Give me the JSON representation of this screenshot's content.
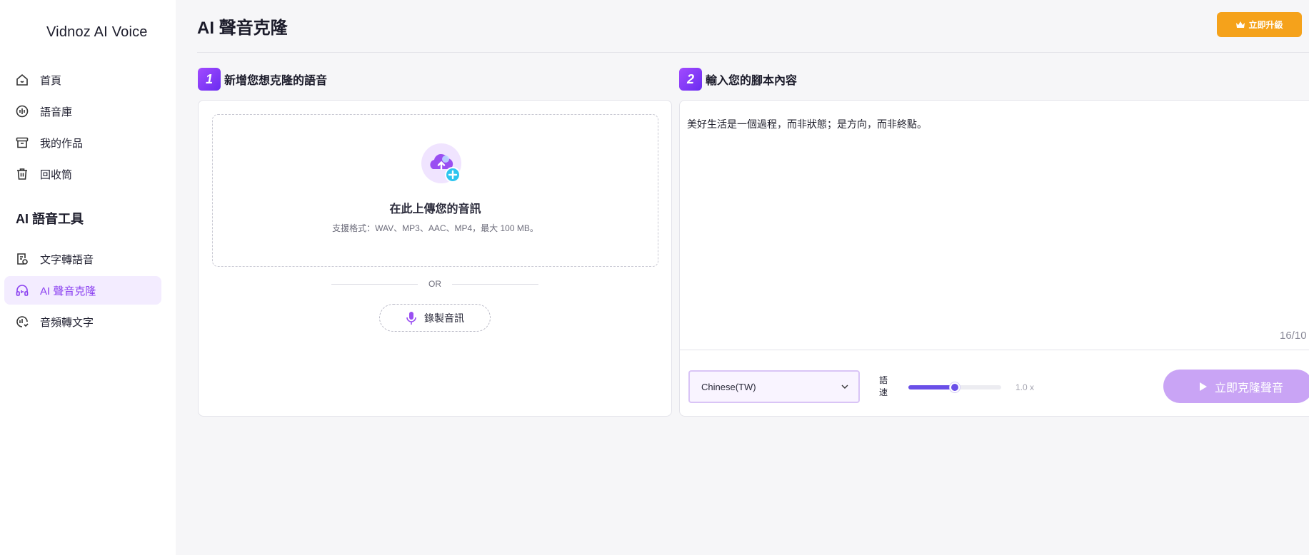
{
  "app": {
    "name": "Vidnoz AI Voice"
  },
  "sidebar": {
    "items": [
      {
        "label": "首頁",
        "icon": "home-icon"
      },
      {
        "label": "語音庫",
        "icon": "voice-library-icon"
      },
      {
        "label": "我的作品",
        "icon": "archive-icon"
      },
      {
        "label": "回收筒",
        "icon": "trash-icon"
      }
    ],
    "section_title": "AI 語音工具",
    "tools": [
      {
        "label": "文字轉語音",
        "icon": "text-to-speech-icon",
        "active": false
      },
      {
        "label": "AI 聲音克隆",
        "icon": "headphones-icon",
        "active": true
      },
      {
        "label": "音頻轉文字",
        "icon": "speech-to-text-icon",
        "active": false
      }
    ]
  },
  "header": {
    "title": "AI 聲音克隆",
    "upgrade_label": "立即升級"
  },
  "step1": {
    "number": "1",
    "label": "新增您想克隆的語音",
    "upload_title": "在此上傳您的音訊",
    "upload_sub": "支援格式：WAV、MP3、AAC、MP4，最大 100 MB。",
    "or_text": "OR",
    "record_label": "錄製音訊"
  },
  "step2": {
    "number": "2",
    "label": "輸入您的腳本內容",
    "script_text": "美好生活是一個過程，而非狀態；是方向，而非終點。",
    "char_count": "16/10",
    "language": "Chinese(TW)",
    "speed_label": "語速",
    "speed_value": "1.0 x",
    "speed_fraction": 0.5,
    "clone_label": "立即克隆聲音"
  },
  "colors": {
    "accent": "#8a3ff0",
    "upgrade": "#f5a21b",
    "clone_button": "#c9a4f5",
    "slider": "#6a4fe8"
  }
}
